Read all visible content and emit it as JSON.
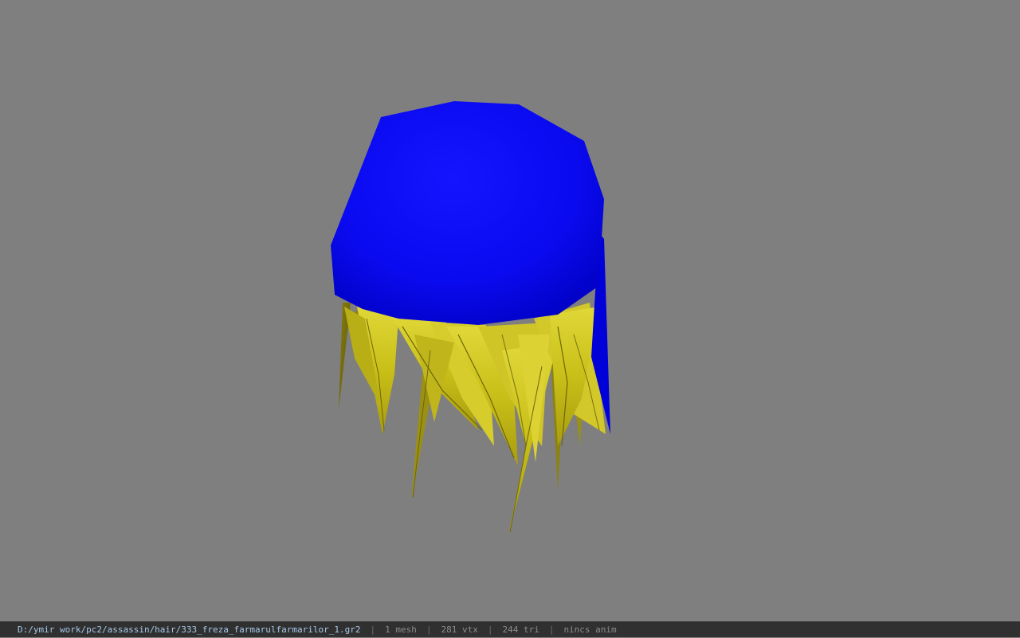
{
  "viewer": {
    "background_color": "#7f7f7f",
    "model": {
      "cap_color": "#0a0aff",
      "hair_color": "#c8c020"
    }
  },
  "statusbar": {
    "file_path": "D:/ymir work/pc2/assassin/hair/333_freza_farmarulfarmarilor_1.gr2",
    "separator": "|",
    "mesh_count": "1 mesh",
    "vertex_count": "281 vtx",
    "triangle_count": "244 tri",
    "anim_status": "nincs anim"
  }
}
